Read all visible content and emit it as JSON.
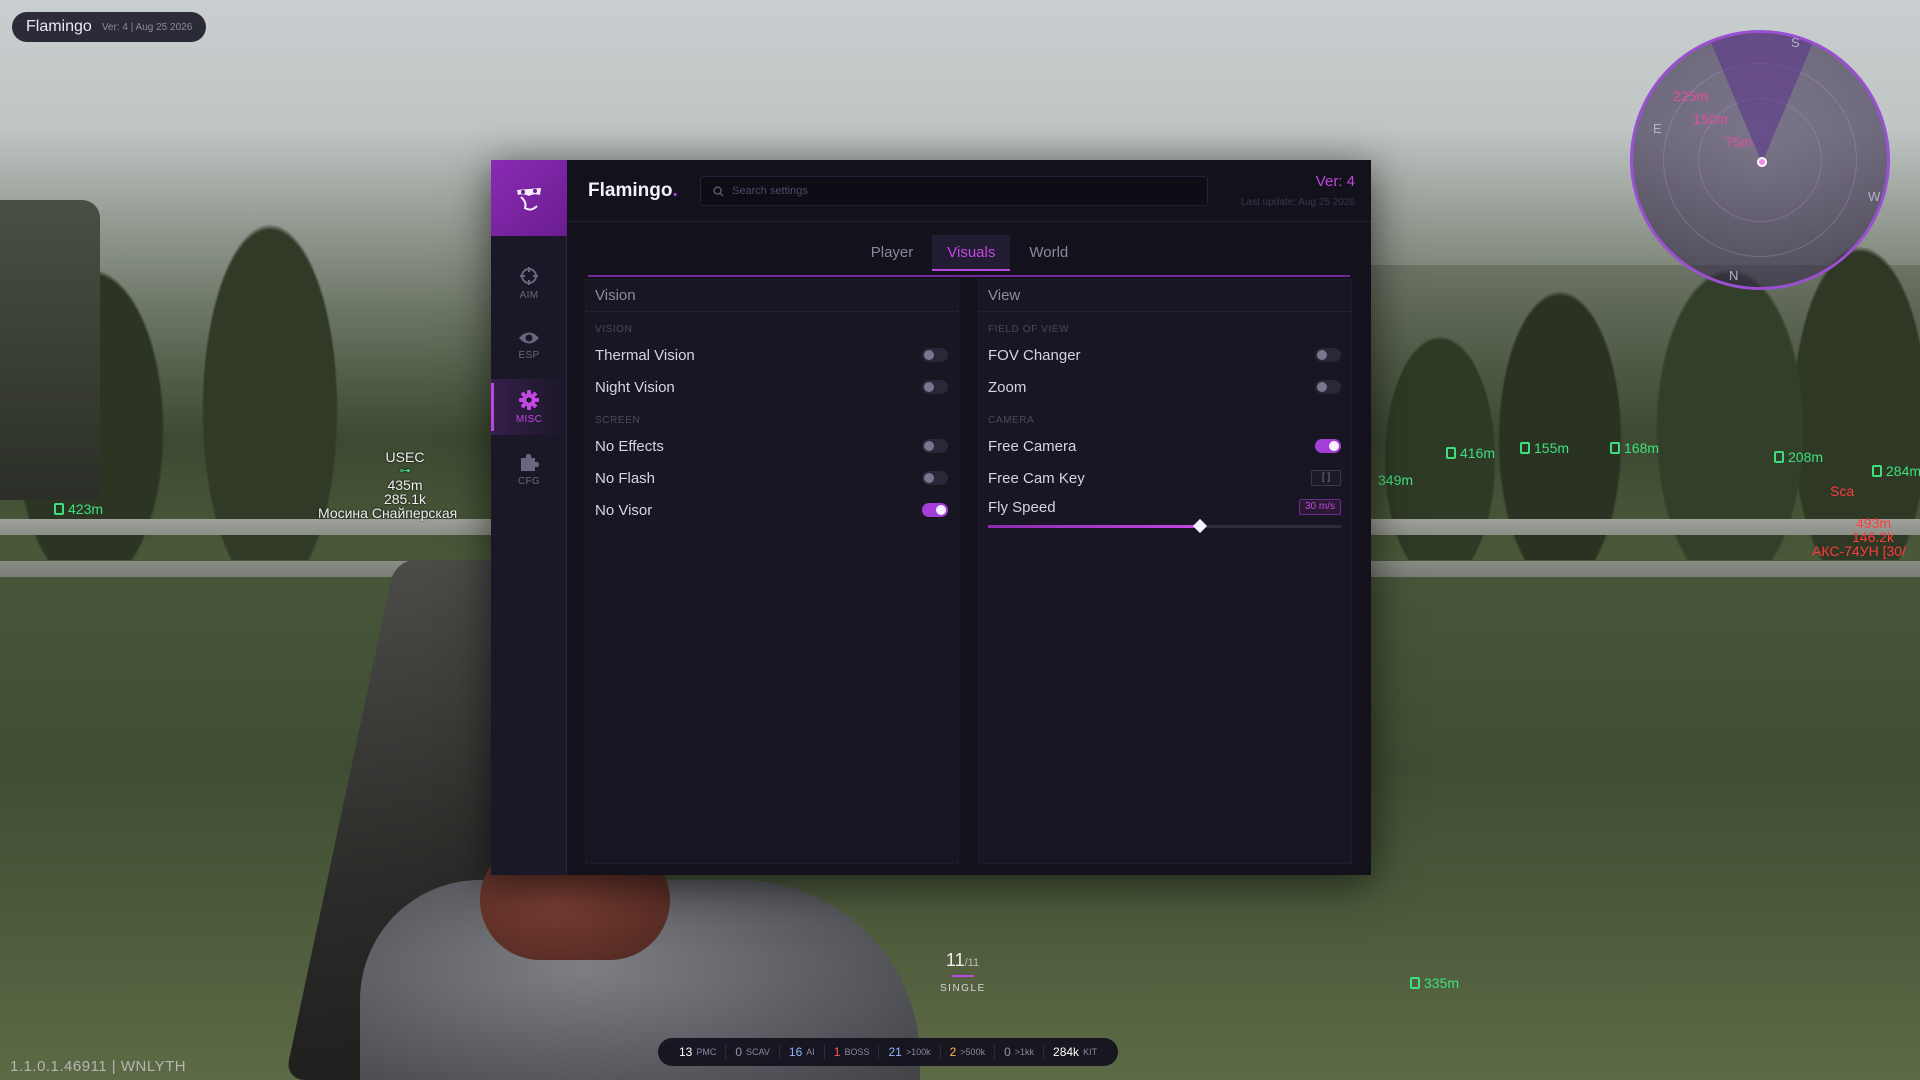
{
  "watermark": {
    "title": "Flamingo",
    "meta": "Ver: 4 | Aug 25 2026"
  },
  "build": "1.1.0.1.46911 | WNLYTH",
  "header": {
    "brand": "Flamingo",
    "brand_dot": ".",
    "search_placeholder": "Search settings",
    "version": "Ver: 4",
    "last_update": "Last update: Aug 25 2026"
  },
  "sidebar": {
    "items": [
      {
        "label": "AIM",
        "icon": "crosshair-icon",
        "active": false
      },
      {
        "label": "ESP",
        "icon": "eye-icon",
        "active": false
      },
      {
        "label": "MISC",
        "icon": "gear-icon",
        "active": true
      },
      {
        "label": "CFG",
        "icon": "puzzle-icon",
        "active": false
      }
    ]
  },
  "tabs": [
    {
      "label": "Player",
      "active": false
    },
    {
      "label": "Visuals",
      "active": true
    },
    {
      "label": "World",
      "active": false
    }
  ],
  "panels": {
    "left": {
      "title": "Vision",
      "sections": [
        {
          "heading": "VISION",
          "rows": [
            {
              "label": "Thermal Vision",
              "on": false
            },
            {
              "label": "Night Vision",
              "on": false
            }
          ]
        },
        {
          "heading": "SCREEN",
          "rows": [
            {
              "label": "No Effects",
              "on": false
            },
            {
              "label": "No Flash",
              "on": false
            },
            {
              "label": "No Visor",
              "on": true
            }
          ]
        }
      ]
    },
    "right": {
      "title": "View",
      "fov_heading": "FIELD OF VIEW",
      "fov_changer": "FOV Changer",
      "zoom": "Zoom",
      "camera_heading": "CAMERA",
      "free_camera": "Free Camera",
      "free_cam_key": "Free Cam Key",
      "free_cam_key_value": "[ ]",
      "fly_speed": "Fly Speed",
      "fly_speed_value": "30 m/s",
      "fly_speed_fraction": 0.6
    }
  },
  "esp": {
    "player_faction": "USEC",
    "player_distance": "435m",
    "player_value": "285.1k",
    "player_weapon": "Мосина Снайперская",
    "loot_left": "423m",
    "loot_349": "349m",
    "loot_416": "416m",
    "loot_155": "155m",
    "loot_168": "168m",
    "loot_208": "208m",
    "loot_284": "284m",
    "loot_335": "335m",
    "enemy_name": "Sca",
    "enemy_dist": "493m",
    "enemy_value": "146.2k",
    "enemy_weapon": "АКС-74УН [30/"
  },
  "radar": {
    "rings": [
      "225m",
      "150m",
      "75m"
    ],
    "cardinals": {
      "n": "N",
      "e": "E",
      "w": "W",
      "s": "S"
    }
  },
  "hud": {
    "ammo": "11",
    "ammo_max": "/11",
    "fire_mode": "SINGLE",
    "stats": [
      {
        "n": "13",
        "l": "PMC",
        "color": "#ffffff"
      },
      {
        "n": "0",
        "l": "SCAV",
        "color": "#9a95aa"
      },
      {
        "n": "16",
        "l": "AI",
        "color": "#8fb8ff"
      },
      {
        "n": "1",
        "l": "BOSS",
        "color": "#ff5a5a"
      },
      {
        "n": "21",
        "l": ">100k",
        "color": "#8fb8ff"
      },
      {
        "n": "2",
        "l": ">500k",
        "color": "#ffb84a"
      },
      {
        "n": "0",
        "l": ">1kk",
        "color": "#9a95aa"
      },
      {
        "n": "284k",
        "l": "KIT",
        "color": "#ffffff"
      }
    ]
  },
  "colors": {
    "accent": "#c447e0",
    "accent_dark": "#8a2bb3",
    "panel_bg": "#13111c",
    "esp_green": "#3ee07e"
  }
}
